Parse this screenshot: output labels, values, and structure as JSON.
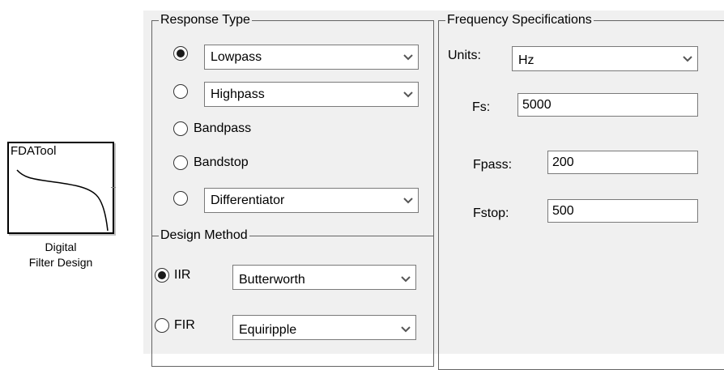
{
  "block": {
    "title": "FDATool",
    "caption_line1": "Digital",
    "caption_line2": "Filter Design",
    "icon": "lowpass-curve-icon"
  },
  "response_type": {
    "title": "Response Type",
    "options": [
      {
        "type": "select",
        "value": "Lowpass",
        "checked": true
      },
      {
        "type": "select",
        "value": "Highpass",
        "checked": false
      },
      {
        "type": "label",
        "value": "Bandpass",
        "checked": false
      },
      {
        "type": "label",
        "value": "Bandstop",
        "checked": false
      },
      {
        "type": "select",
        "value": "Differentiator",
        "checked": false
      }
    ]
  },
  "design_method": {
    "title": "Design Method",
    "iir": {
      "label": "IIR",
      "value": "Butterworth",
      "checked": true
    },
    "fir": {
      "label": "FIR",
      "value": "Equiripple",
      "checked": false
    }
  },
  "freq_spec": {
    "title": "Frequency Specifications",
    "units_label": "Units:",
    "units_value": "Hz",
    "fs_label": "Fs:",
    "fs_value": "5000",
    "fpass_label": "Fpass:",
    "fpass_value": "200",
    "fstop_label": "Fstop:",
    "fstop_value": "500"
  }
}
